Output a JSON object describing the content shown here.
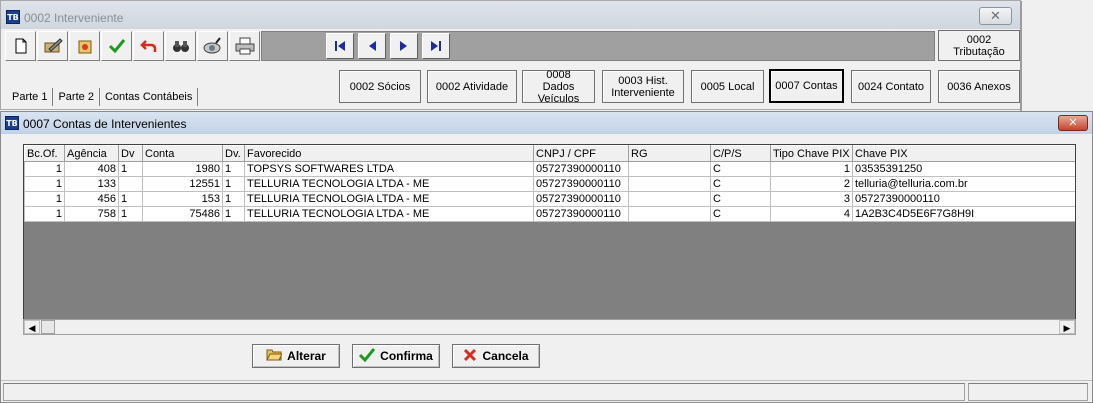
{
  "back_window": {
    "title": "0002 Interveniente",
    "close_label": "✕",
    "tributacao_label": "0002\nTributação",
    "tabs": [
      "Parte 1",
      "Parte 2",
      "Contas Contábeis"
    ],
    "buttons": [
      {
        "label": "0002 Sócios"
      },
      {
        "label": "0002 Atividade"
      },
      {
        "label": "0008 Dados Veículos"
      },
      {
        "label": "0003 Hist. Interveniente"
      },
      {
        "label": "0005 Local"
      },
      {
        "label": "0007 Contas"
      },
      {
        "label": "0024 Contato"
      },
      {
        "label": "0036 Anexos"
      }
    ]
  },
  "front_window": {
    "title": "0007 Contas de Intervenientes",
    "close_label": "✕",
    "grid": {
      "columns": [
        "Bc.Of.",
        "Agência",
        "Dv",
        "Conta",
        "Dv.",
        "Favorecido",
        "CNPJ / CPF",
        "RG",
        "C/P/S",
        "Tipo Chave PIX",
        "Chave PIX"
      ],
      "rows": [
        [
          "1",
          "408",
          "1",
          "1980",
          "1",
          "TOPSYS SOFTWARES LTDA",
          "05727390000110",
          "",
          "C",
          "1",
          "03535391250"
        ],
        [
          "1",
          "133",
          "",
          "12551",
          "1",
          "TELLURIA TECNOLOGIA LTDA - ME",
          "05727390000110",
          "",
          "C",
          "2",
          "telluria@telluria.com.br"
        ],
        [
          "1",
          "456",
          "1",
          "153",
          "1",
          "TELLURIA TECNOLOGIA LTDA - ME",
          "05727390000110",
          "",
          "C",
          "3",
          "05727390000110"
        ],
        [
          "1",
          "758",
          "1",
          "75486",
          "1",
          "TELLURIA TECNOLOGIA LTDA - ME",
          "05727390000110",
          "",
          "C",
          "4",
          "1A2B3C4D5E6F7G8H9I"
        ]
      ]
    },
    "actions": {
      "alterar": "Alterar",
      "confirma": "Confirma",
      "cancela": "Cancela"
    }
  },
  "icons": [
    "new-document-icon",
    "edit-icon",
    "delete-icon",
    "confirm-check-icon",
    "undo-icon",
    "binoculars-icon",
    "search-lens-icon",
    "printer-icon",
    "first-record-icon",
    "previous-record-icon",
    "next-record-icon",
    "last-record-icon",
    "folder-open-icon",
    "green-check-icon",
    "red-x-icon"
  ]
}
